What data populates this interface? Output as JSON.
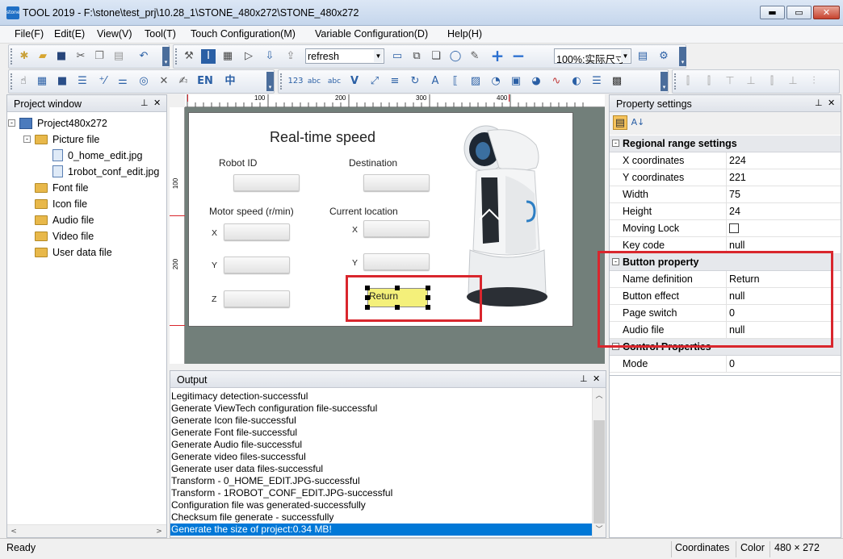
{
  "window": {
    "title": "TOOL 2019 - F:\\stone\\test_prj\\10.28_1\\STONE_480x272\\STONE_480x272",
    "icon_text": "stone",
    "min": "▬",
    "max": "▭",
    "close": "✕"
  },
  "menu": [
    "File(F)",
    "Edit(E)",
    "View(V)",
    "Tool(T)",
    "Touch Configuration(M)",
    "Variable Configuration(D)",
    "Help(H)"
  ],
  "toolbar": {
    "refresh_combo": "refresh",
    "zoom_combo": "100%:实际尺寸",
    "en_label": "EN",
    "zh_label": "中",
    "num_label": "123"
  },
  "project_window": {
    "title": "Project window",
    "root": "Project480x272",
    "items": [
      {
        "label": "Picture file"
      },
      {
        "label": "0_home_edit.jpg"
      },
      {
        "label": "1robot_conf_edit.jpg"
      },
      {
        "label": "Font file"
      },
      {
        "label": "Icon file"
      },
      {
        "label": "Audio file"
      },
      {
        "label": "Video file"
      },
      {
        "label": "User data file"
      }
    ]
  },
  "ruler": {
    "top": [
      "100",
      "200",
      "300",
      "400"
    ],
    "left": [
      "100",
      "200"
    ]
  },
  "canvas": {
    "title": "Real-time speed",
    "robot_id": "Robot ID",
    "destination": "Destination",
    "motor_speed": "Motor speed (r/min)",
    "current_location": "Current location",
    "x": "X",
    "y": "Y",
    "z": "Z",
    "return_label": "Return"
  },
  "properties": {
    "title": "Property settings",
    "sections": [
      {
        "name": "Regional range settings",
        "rows": [
          {
            "k": "X coordinates",
            "v": "224"
          },
          {
            "k": "Y coordinates",
            "v": "221"
          },
          {
            "k": "Width",
            "v": "75"
          },
          {
            "k": "Height",
            "v": "24"
          },
          {
            "k": "Moving Lock",
            "v": ""
          },
          {
            "k": "Key code",
            "v": "null"
          }
        ]
      },
      {
        "name": "Button property",
        "rows": [
          {
            "k": "Name definition",
            "v": "Return"
          },
          {
            "k": "Button effect",
            "v": "null"
          },
          {
            "k": "Page switch",
            "v": "0"
          },
          {
            "k": "Audio file",
            "v": "null"
          }
        ]
      },
      {
        "name": "Control Properties",
        "rows": [
          {
            "k": "Mode",
            "v": "0"
          }
        ]
      }
    ]
  },
  "output": {
    "title": "Output",
    "lines": [
      "Legitimacy detection-successful",
      "Generate ViewTech configuration file-successful",
      "Generate Icon file-successful",
      "Generate Font file-successful",
      "Generate Audio file-successful",
      "Generate video files-successful",
      "Generate user data files-successful",
      "Transform - 0_HOME_EDIT.JPG-successful",
      "Transform - 1ROBOT_CONF_EDIT.JPG-successful",
      "Configuration file was generated-successfully",
      "Checksum file generate - successfully",
      "Generate the size of project:0.34 MB!"
    ]
  },
  "status": {
    "ready": "Ready",
    "coordinates": "Coordinates",
    "color": "Color",
    "resolution": "480 × 272"
  },
  "colors": {
    "selection": "#0078d7",
    "highlight_box": "#d9262d",
    "button_fill": "#f4f07a",
    "design_bg": "#727f7a"
  }
}
